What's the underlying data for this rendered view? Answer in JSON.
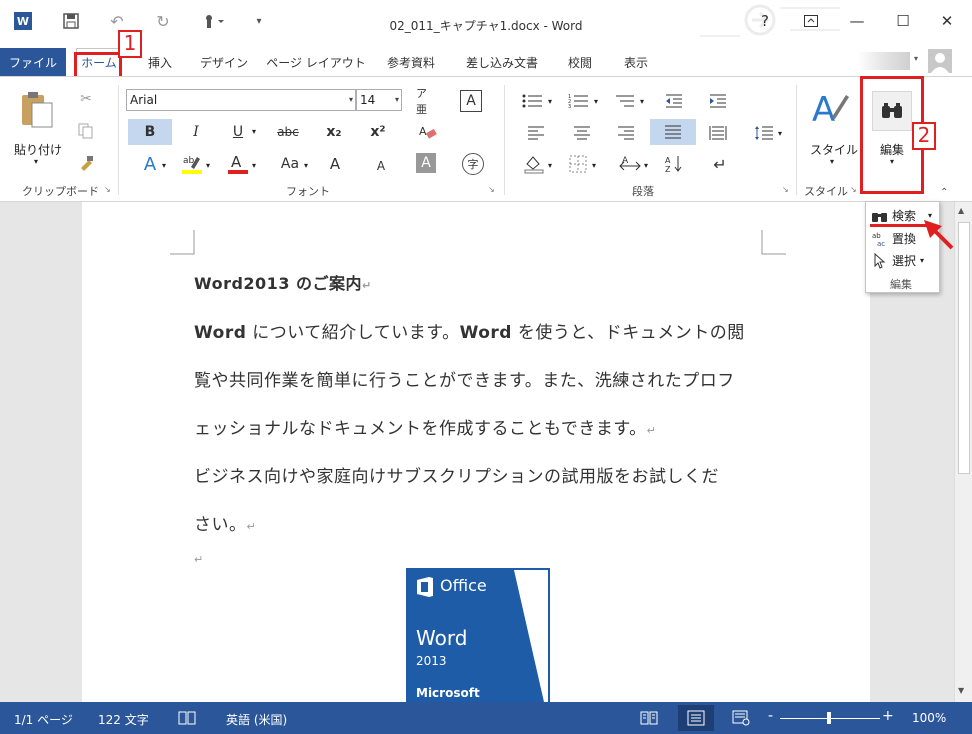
{
  "window": {
    "title": "02_011_キャプチャ1.docx - Word",
    "help": "?",
    "min": "—",
    "max": "☐",
    "close": "✕"
  },
  "qat": {
    "word_icon": "W",
    "undo": "↶",
    "redo": "↻"
  },
  "tabs": {
    "file": "ファイル",
    "home": "ホーム",
    "insert": "挿入",
    "design": "デザイン",
    "layout": "ページ レイアウト",
    "references": "参考資料",
    "mailings": "差し込み文書",
    "review": "校閲",
    "view": "表示"
  },
  "annotations": {
    "badge1": "1",
    "badge2": "2"
  },
  "ribbon": {
    "clipboard": {
      "paste": "貼り付け",
      "label": "クリップボード"
    },
    "font": {
      "name": "Arial",
      "size": "14",
      "label": "フォント",
      "bold": "B",
      "italic": "I",
      "underline": "U",
      "strike": "abc",
      "sub": "x₂",
      "sup": "x²",
      "aa": "Aa",
      "grow": "A",
      "shrink": "A"
    },
    "paragraph": {
      "label": "段落"
    },
    "styles": {
      "button": "スタイル",
      "label": "スタイル"
    },
    "editing": {
      "button": "編集"
    }
  },
  "editing_popup": {
    "find": "検索",
    "replace": "置換",
    "select": "選択",
    "label": "編集"
  },
  "document": {
    "heading": "Word2013 のご案内",
    "p1_line1_bold1": "Word",
    "p1_line1_a": " について紹介しています。",
    "p1_line1_bold2": "Word",
    "p1_line1_b": " を使うと、ドキュメントの閲",
    "p1_line2": "覧や共同作業を簡単に行うことができます。また、洗練されたプロフ",
    "p1_line3": "ェッショナルなドキュメントを作成することもできます。",
    "p2_line1": "ビジネス向けや家庭向けサブスクリプションの試用版をお試しくだ",
    "p2_line2": "さい。",
    "para_mark": "↵",
    "image": {
      "brand": "Office",
      "product": "Word",
      "year": "2013",
      "vendor": "Microsoft"
    }
  },
  "status": {
    "page": "1/1 ページ",
    "words": "122 文字",
    "lang": "英語 (米国)",
    "zoom": "100%",
    "minus": "-",
    "plus": "+"
  },
  "colors": {
    "accent": "#2b579a",
    "annotation": "#e02020"
  }
}
